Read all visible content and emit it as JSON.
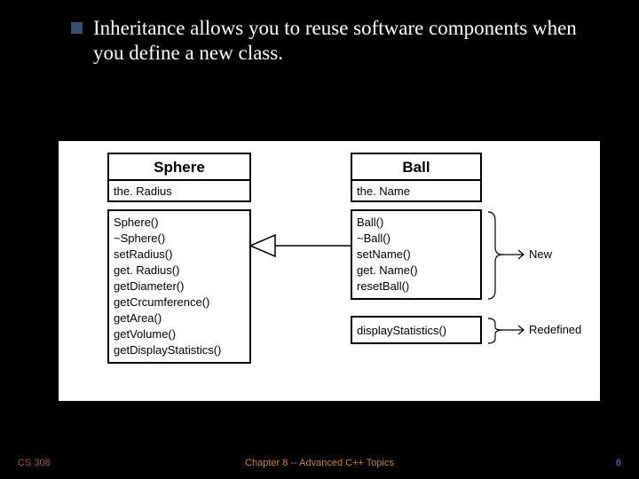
{
  "body_text": "Inheritance allows you to reuse software components when you define a new class.",
  "footer": {
    "left": "CS 308",
    "center": "Chapter 8 -- Advanced C++ Topics",
    "right": "6"
  },
  "chart_data": {
    "type": "diagram",
    "diagram_type": "uml_class_inheritance",
    "classes": [
      {
        "name": "Sphere",
        "attributes": [
          "the. Radius"
        ],
        "methods": [
          "Sphere()",
          "~Sphere()",
          "setRadius()",
          "get. Radius()",
          "getDiameter()",
          "getCrcumference()",
          "getArea()",
          "getVolume()",
          "getDisplayStatistics()"
        ]
      },
      {
        "name": "Ball",
        "attributes": [
          "the. Name"
        ],
        "methods_new": [
          "Ball()",
          "~Ball()",
          "setName()",
          "get. Name()",
          "resetBall()"
        ],
        "methods_redefined": [
          "displayStatistics()"
        ]
      }
    ],
    "relationship": {
      "from": "Ball",
      "to": "Sphere",
      "type": "inheritance"
    },
    "annotations": [
      "New",
      "Redefined"
    ]
  }
}
